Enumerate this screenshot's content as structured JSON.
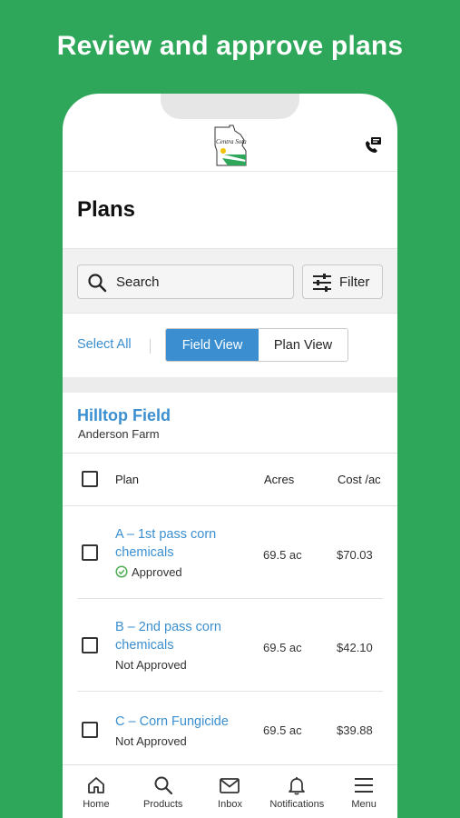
{
  "headline": "Review and approve plans",
  "header": {
    "logo_text": "Centra Sota"
  },
  "page": {
    "title": "Plans"
  },
  "search": {
    "label": "Search"
  },
  "filter": {
    "label": "Filter"
  },
  "view": {
    "select_all": "Select All",
    "field_view": "Field View",
    "plan_view": "Plan View"
  },
  "field": {
    "name": "Hilltop Field",
    "farm": "Anderson Farm"
  },
  "table": {
    "headers": {
      "plan": "Plan",
      "acres": "Acres",
      "cost": "Cost /ac"
    },
    "rows": [
      {
        "line1": "A – 1st pass corn",
        "line2": "chemicals",
        "status": "Approved",
        "acres": "69.5 ac",
        "cost": "$70.03"
      },
      {
        "line1": "B – 2nd pass corn",
        "line2": "chemicals",
        "status": "Not Approved",
        "acres": "69.5 ac",
        "cost": "$42.10"
      },
      {
        "line1": "C – Corn Fungicide",
        "line2": "",
        "status": "Not Approved",
        "acres": "69.5 ac",
        "cost": "$39.88"
      }
    ]
  },
  "nav": {
    "items": [
      {
        "label": "Home",
        "icon": "home-icon"
      },
      {
        "label": "Products",
        "icon": "search-icon"
      },
      {
        "label": "Inbox",
        "icon": "mail-icon"
      },
      {
        "label": "Notifications",
        "icon": "bell-icon"
      },
      {
        "label": "Menu",
        "icon": "menu-icon"
      }
    ]
  },
  "colors": {
    "background": "#2fa75a",
    "accent": "#3b8fd0",
    "approved": "#4caf50"
  }
}
